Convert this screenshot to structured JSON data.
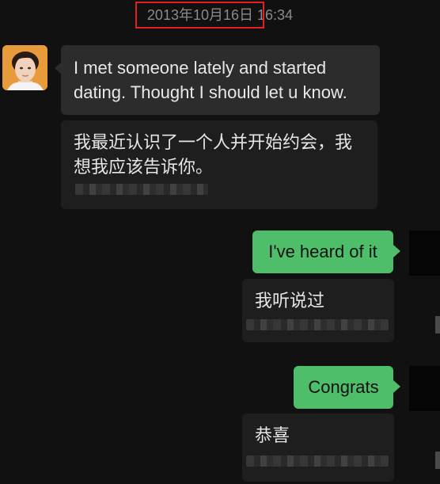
{
  "chat": {
    "timestamp": "2013年10月16日 16:34",
    "messages": [
      {
        "sender": "contact",
        "text": "I met someone lately and started dating.  Thought I should let u know.",
        "translation": "我最近认识了一个人并开始约会，我想我应该告诉你。"
      },
      {
        "sender": "self",
        "text": "I've heard of it",
        "translation": "我听说过"
      },
      {
        "sender": "self",
        "text": "Congrats",
        "translation": "恭喜"
      }
    ]
  },
  "colors": {
    "background": "#111111",
    "incoming_bubble": "#2c2c2c",
    "outgoing_bubble": "#4fbe6a",
    "highlight": "#e0211d",
    "timestamp_text": "#8a8a8a"
  },
  "icons": {
    "contact_avatar": "contact-avatar",
    "self_avatar": "self-avatar"
  }
}
